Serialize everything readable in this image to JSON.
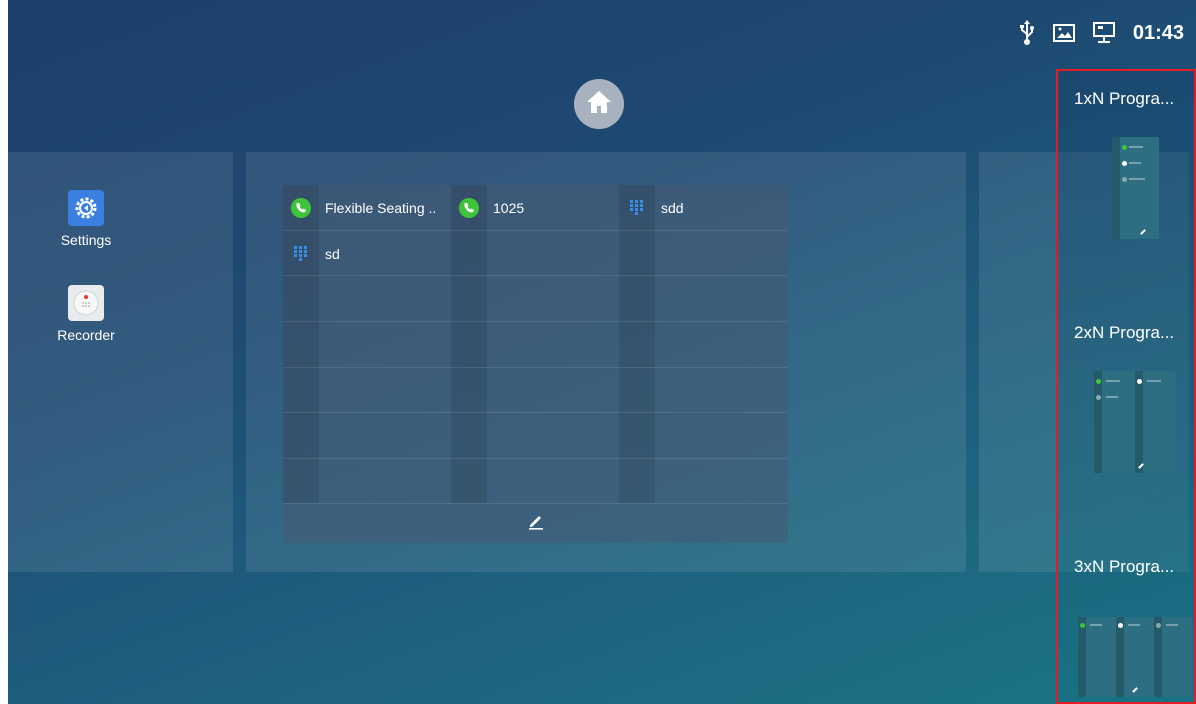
{
  "status": {
    "time": "01:43",
    "icons": [
      "usb-icon",
      "image-icon",
      "network-icon"
    ]
  },
  "home": {
    "icon": "home-icon"
  },
  "apps": [
    {
      "label": "Settings",
      "icon": "gear-icon"
    },
    {
      "label": "Recorder",
      "icon": "recorder-icon"
    }
  ],
  "widget": {
    "slots": [
      {
        "label": "Flexible Seating ..",
        "icon": "phone-icon"
      },
      {
        "label": "1025",
        "icon": "phone-icon"
      },
      {
        "label": "sdd",
        "icon": "dialpad-icon"
      },
      {
        "label": "sd",
        "icon": "dialpad-icon"
      }
    ],
    "edit_icon": "pencil-icon"
  },
  "programmable_layouts": [
    {
      "title": "1xN Progra..."
    },
    {
      "title": "2xN Progra..."
    },
    {
      "title": "3xN Progra..."
    }
  ],
  "colors": {
    "call_green": "#3ec43a",
    "dialpad_blue": "#3b8ee6",
    "highlight_red": "#e51c23"
  }
}
